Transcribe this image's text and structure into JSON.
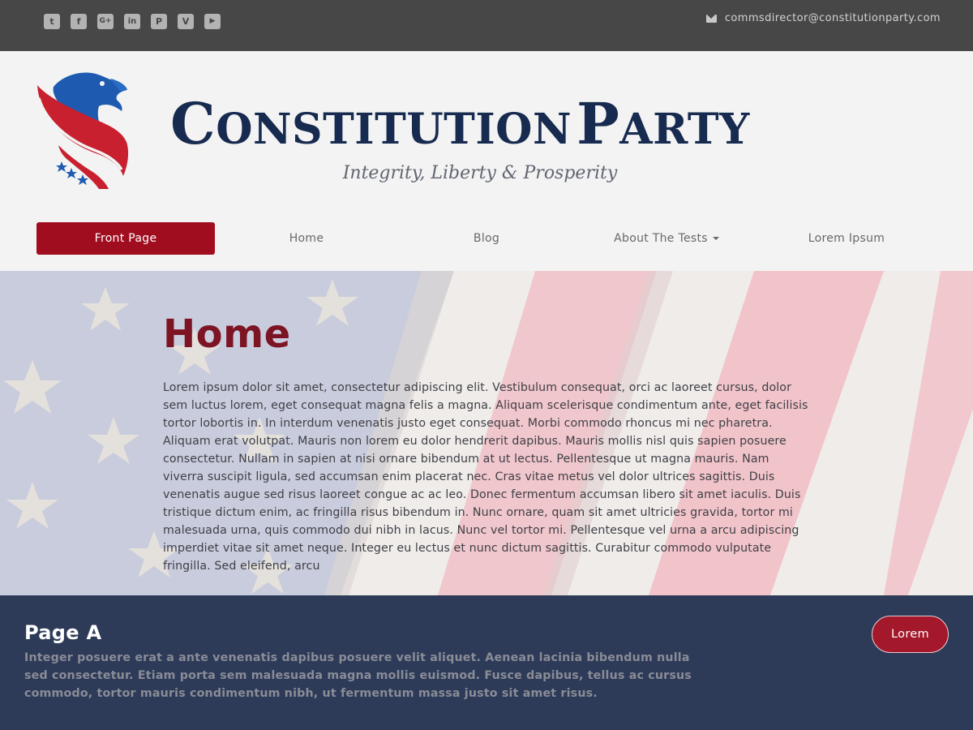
{
  "topbar": {
    "social": [
      {
        "name": "twitter-icon",
        "glyph": "t"
      },
      {
        "name": "facebook-icon",
        "glyph": "f"
      },
      {
        "name": "google-plus-icon",
        "glyph": "G+"
      },
      {
        "name": "linkedin-icon",
        "glyph": "in"
      },
      {
        "name": "pinterest-icon",
        "glyph": "P"
      },
      {
        "name": "vimeo-icon",
        "glyph": "V"
      },
      {
        "name": "youtube-icon",
        "glyph": "▶"
      }
    ],
    "email": "commsdirector@constitutionparty.com"
  },
  "brand": {
    "title_part1_initial": "C",
    "title_part1_rest": "ONSTITUTION",
    "title_part2_initial": "P",
    "title_part2_rest": "ARTY",
    "tagline": "Integrity, Liberty & Prosperity"
  },
  "nav": {
    "items": [
      {
        "label": "Front Page"
      },
      {
        "label": "Home"
      },
      {
        "label": "Blog"
      },
      {
        "label": "About The Tests"
      },
      {
        "label": "Lorem Ipsum"
      }
    ]
  },
  "hero": {
    "title": "Home",
    "body": "Lorem ipsum dolor sit amet, consectetur adipiscing elit. Vestibulum consequat, orci ac laoreet cursus, dolor sem luctus lorem, eget consequat magna felis a magna. Aliquam scelerisque condimentum ante, eget facilisis tortor lobortis in. In interdum venenatis justo eget consequat. Morbi commodo rhoncus mi nec pharetra. Aliquam erat volutpat. Mauris non lorem eu dolor hendrerit dapibus. Mauris mollis nisl quis sapien posuere consectetur. Nullam in sapien at nisi ornare bibendum at ut lectus. Pellentesque ut magna mauris. Nam viverra suscipit ligula, sed accumsan enim placerat nec. Cras vitae metus vel dolor ultrices sagittis. Duis venenatis augue sed risus laoreet congue ac ac leo. Donec fermentum accumsan libero sit amet iaculis. Duis tristique dictum enim, ac fringilla risus bibendum in. Nunc ornare, quam sit amet ultricies gravida, tortor mi malesuada urna, quis commodo dui nibh in lacus. Nunc vel tortor mi. Pellentesque vel urna a arcu adipiscing imperdiet vitae sit amet neque. Integer eu lectus et nunc dictum sagittis. Curabitur commodo vulputate fringilla. Sed eleifend, arcu"
  },
  "band": {
    "title": "Page A",
    "body": "Integer posuere erat a ante venenatis dapibus posuere velit aliquet. Aenean lacinia bibendum nulla sed consectetur. Etiam porta sem malesuada magna mollis euismod. Fusce dapibus, tellus ac cursus commodo, tortor mauris condimentum nibh, ut fermentum massa justo sit amet risus.",
    "button_label": "Lorem"
  },
  "colors": {
    "topbar": "#474747",
    "navy": "#172a4f",
    "accent_red": "#a00d1f",
    "band_bg": "#2d3b59",
    "hero_title": "#7d1424"
  }
}
